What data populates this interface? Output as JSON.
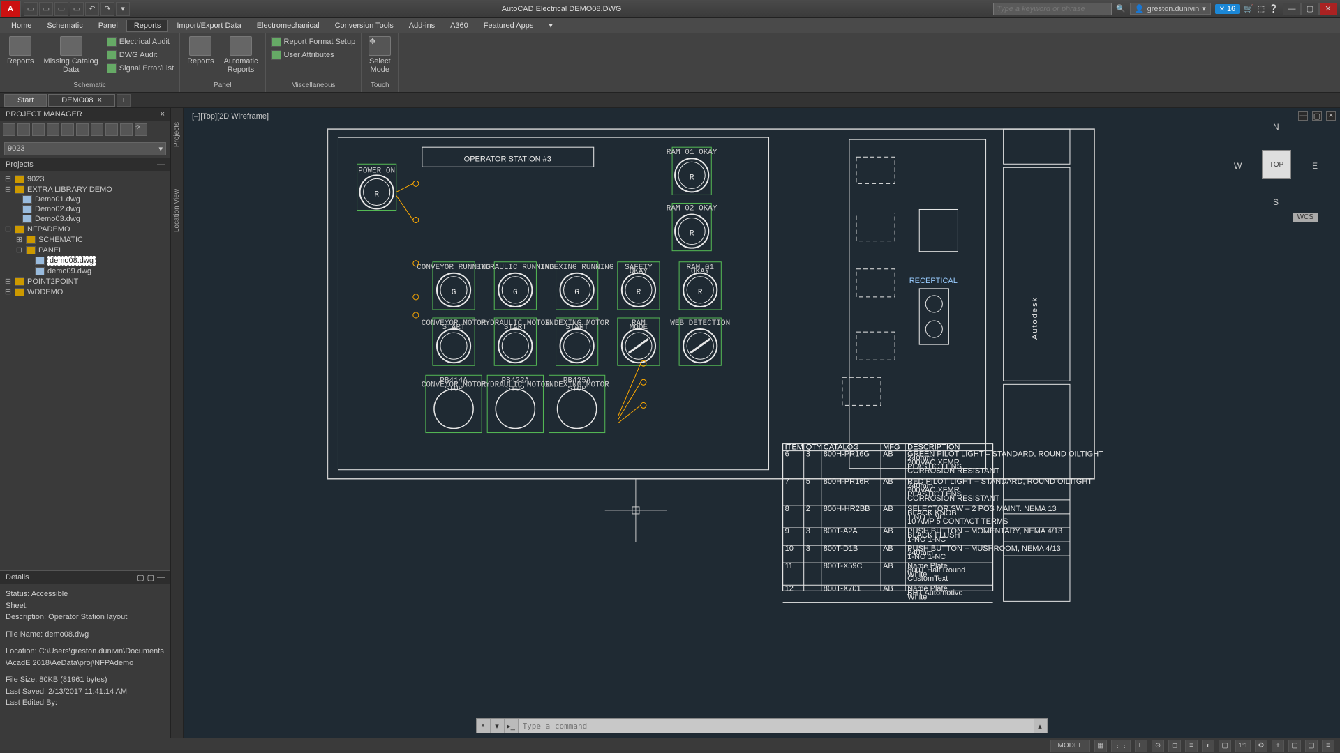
{
  "title": "AutoCAD Electrical   DEMO08.DWG",
  "search_placeholder": "Type a keyword or phrase",
  "login": "greston.dunivin",
  "notif_count": "16",
  "menu": [
    "Home",
    "Schematic",
    "Panel",
    "Reports",
    "Import/Export Data",
    "Electromechanical",
    "Conversion Tools",
    "Add-ins",
    "A360",
    "Featured Apps"
  ],
  "menu_active": 3,
  "ribbon": {
    "schematic": {
      "title": "Schematic",
      "reports": "Reports",
      "missing": "Missing Catalog\nData",
      "audit": "Electrical Audit",
      "dwg": "DWG Audit",
      "signal": "Signal Error/List"
    },
    "panel": {
      "title": "Panel",
      "reports": "Reports",
      "auto": "Automatic\nReports"
    },
    "misc": {
      "title": "Miscellaneous",
      "format": "Report Format Setup",
      "user": "User Attributes"
    },
    "touch": {
      "title": "Touch",
      "select": "Select\nMode"
    }
  },
  "doctabs": {
    "start": "Start",
    "doc": "DEMO08"
  },
  "pm": {
    "head": "PROJECT MANAGER",
    "combo": "9023",
    "proj_head": "Projects",
    "tree": {
      "p1": "9023",
      "p2": "EXTRA LIBRARY DEMO",
      "p2a": "Demo01.dwg",
      "p2b": "Demo02.dwg",
      "p2c": "Demo03.dwg",
      "p3": "NFPADEMO",
      "p3a": "SCHEMATIC",
      "p3b": "PANEL",
      "p3b1": "demo08.dwg",
      "p3b2": "demo09.dwg",
      "p4": "POINT2POINT",
      "p5": "WDDEMO"
    },
    "details": {
      "head": "Details",
      "status": "Status: Accessible",
      "sheet": "Sheet:",
      "desc": "Description: Operator Station layout",
      "file": "File Name: demo08.dwg",
      "loc": "Location: C:\\Users\\greston.dunivin\\Documents\\AcadE 2018\\AeData\\proj\\NFPAdemo",
      "size": "File Size: 80KB (81961 bytes)",
      "saved": "Last Saved: 2/13/2017 11:41:14 AM",
      "edited": "Last Edited By:"
    },
    "side1": "Projects",
    "side2": "Location View"
  },
  "view_label": "[–][Top][2D Wireframe]",
  "wcs": "WCS",
  "nav": {
    "top": "TOP",
    "n": "N",
    "s": "S",
    "e": "E",
    "w": "W"
  },
  "cmd_placeholder": "Type a command",
  "drawing": {
    "title": "OPERATOR STATION #3",
    "power_on": "POWER\nON",
    "ram01": "RAM 01\nOKAY",
    "ram02": "RAM 02\nOKAY",
    "row2": [
      "CONVEYOR RUNNING",
      "HYDRAULIC RUNNING",
      "INDEXING RUNNING",
      "SAFETY\nOKAY",
      "RAM 01\nOKAY"
    ],
    "row2_letters": [
      "G",
      "G",
      "G",
      "R",
      "R"
    ],
    "row3": [
      "CONVEYOR MOTOR\nSTART",
      "HYDRAULIC MOTOR\nSTART",
      "INDEXING MOTOR\nSTART",
      "RAM\nMODE",
      "WEB DETECTION"
    ],
    "row4": [
      "PB414A\nCONVEYOR MOTOR\nSTOP",
      "PB422A\nHYDRAULIC MOTOR\nSTOP",
      "PB425A\nINDEXING MOTOR\nSTOP"
    ],
    "recept": "RECEPTICAL"
  },
  "table_header": [
    "ITEM",
    "QTY",
    "CATALOG",
    "MFG",
    "DESCRIPTION"
  ],
  "table_rows": [
    {
      "i": "6",
      "q": "3",
      "cat": "800H-PR16G",
      "m": "AB",
      "d": "GREEN PILOT LIGHT – STANDARD, ROUND OILTIGHT\n240mm\n200VAC XFMR\nPLASTIC LENS\nCORROSION RESISTANT"
    },
    {
      "i": "7",
      "q": "5",
      "cat": "800H-PR16R",
      "m": "AB",
      "d": "RED PILOT LIGHT – STANDARD, ROUND OILTIGHT\n240mm\n200VAC XFMR\nPLASTIC LENS\nCORROSION RESISTANT"
    },
    {
      "i": "8",
      "q": "2",
      "cat": "800H-HR2BB",
      "m": "AB",
      "d": "SELECTOR SW – 2 POS MAINT. NEMA 13\nBLACK KNOB\n1 NO 1 NC\n10 AMP 5 CONTACT TERMS"
    },
    {
      "i": "9",
      "q": "3",
      "cat": "800T-A2A",
      "m": "AB",
      "d": "PUSH BUTTON – MOMENTARY, NEMA 4/13\nBLACK FLUSH\n1-NO 1-NC"
    },
    {
      "i": "10",
      "q": "3",
      "cat": "800T-D1B",
      "m": "AB",
      "d": "PUSH BUTTON – MUSHROOM, NEMA 4/13\n240mm\n1-NO 1-NC"
    },
    {
      "i": "11",
      "q": "",
      "cat": "800T-X59C",
      "m": "AB",
      "d": "Name Plate\n800T Half Round\nWhite\nCustomText"
    },
    {
      "i": "12",
      "q": "",
      "cat": "800T-X701",
      "m": "AB",
      "d": "Name Plate\nBHT Automotive\nWhite"
    }
  ],
  "status": {
    "model": "MODEL",
    "scale": "1:1"
  }
}
